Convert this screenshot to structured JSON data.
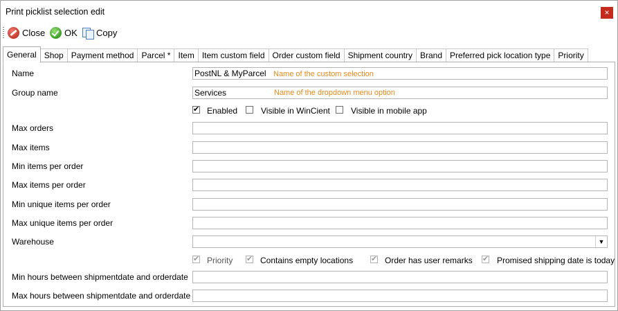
{
  "window": {
    "title": "Print picklist selection edit",
    "close_glyph": "×",
    "close_color": "#c42b1c"
  },
  "toolbar": {
    "close_label": "Close",
    "close_icon": "close-circle-icon",
    "ok_label": "OK",
    "ok_icon": "check-circle-icon",
    "copy_label": "Copy",
    "copy_icon": "copy-icon"
  },
  "tabs": [
    {
      "label": "General",
      "active": true
    },
    {
      "label": "Shop"
    },
    {
      "label": "Payment method"
    },
    {
      "label": "Parcel *"
    },
    {
      "label": "Item"
    },
    {
      "label": "Item custom field"
    },
    {
      "label": "Order custom field"
    },
    {
      "label": "Shipment country"
    },
    {
      "label": "Brand"
    },
    {
      "label": "Preferred pick location type"
    },
    {
      "label": "Priority"
    }
  ],
  "form": {
    "name": {
      "label": "Name",
      "value": "PostNL & MyParcel",
      "hint": "Name of the custom selection"
    },
    "group_name": {
      "label": "Group name",
      "value": "Services",
      "hint": "Name of the dropdown menu option"
    },
    "enabled": {
      "label": "Enabled",
      "checked": true
    },
    "visible_wincient": {
      "label": "Visible in WinCient",
      "checked": false
    },
    "visible_mobile": {
      "label": "Visible in mobile app",
      "checked": false
    },
    "max_orders": {
      "label": "Max orders",
      "value": ""
    },
    "max_items": {
      "label": "Max items",
      "value": ""
    },
    "min_items_per_order": {
      "label": "Min items per order",
      "value": ""
    },
    "max_items_per_order": {
      "label": "Max items per order",
      "value": ""
    },
    "min_unique_items": {
      "label": "Min unique items per order",
      "value": ""
    },
    "max_unique_items": {
      "label": "Max unique items per order",
      "value": ""
    },
    "warehouse": {
      "label": "Warehouse",
      "value": "",
      "dropdown_glyph": "▼"
    },
    "priority": {
      "label": "Priority",
      "checked": true,
      "disabled": true
    },
    "contains_empty": {
      "label": "Contains empty locations",
      "checked": true,
      "disabled": true
    },
    "user_remarks": {
      "label": "Order has user remarks",
      "checked": true,
      "disabled": true
    },
    "promised_today": {
      "label": "Promised shipping date is today",
      "checked": true,
      "disabled": true
    },
    "min_hours": {
      "label": "Min hours between shipmentdate and orderdate",
      "value": ""
    },
    "max_hours": {
      "label": "Max hours between shipmentdate and orderdate",
      "value": ""
    }
  },
  "colors": {
    "hint": "#e8891a",
    "accent_close": "#c42b1c"
  }
}
